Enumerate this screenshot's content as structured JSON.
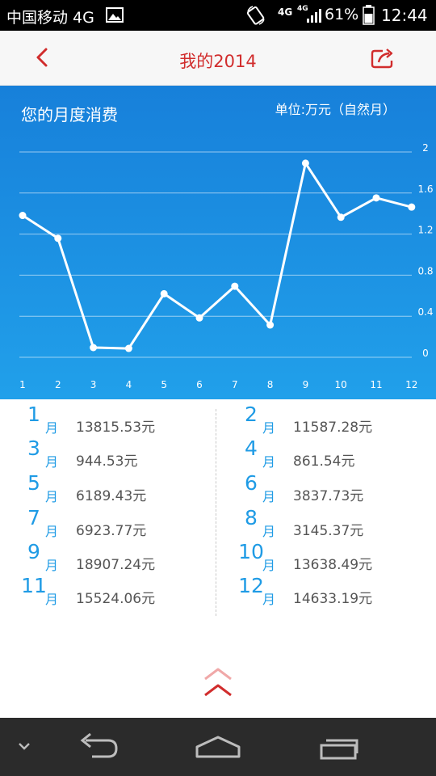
{
  "status_bar": {
    "carrier": "中国移动 4G",
    "network_1": "4G",
    "network_2": "4G",
    "battery": "61%",
    "time": "12:44",
    "icons": [
      "image-icon",
      "screen-rotation-icon",
      "signal-icon",
      "battery-icon"
    ]
  },
  "header": {
    "title": "我的2014",
    "back_icon": "chevron-left-icon",
    "share_icon": "share-icon"
  },
  "colors": {
    "accent": "#d12d2d",
    "chart_bg_top": "#1780da",
    "chart_bg_bottom": "#21a0ea",
    "month_number": "#1f9be5",
    "amount_text": "#555555"
  },
  "chart_title": "您的月度消费",
  "chart_unit": "单位:万元（自然月）",
  "chart_data": {
    "type": "line",
    "x": [
      1,
      2,
      3,
      4,
      5,
      6,
      7,
      8,
      9,
      10,
      11,
      12
    ],
    "x_tick_labels": [
      "1",
      "2",
      "3",
      "4",
      "5",
      "6",
      "7",
      "8",
      "9",
      "10",
      "11",
      "12"
    ],
    "series": [
      {
        "values": [
          1.3815553,
          1.1587228,
          0.0944553,
          0.0861554,
          0.6189443,
          0.3837773,
          0.6923777,
          0.3145337,
          1.8907224,
          1.3638449,
          1.5524006,
          1.4633319
        ]
      }
    ],
    "y_ticks": [
      "0",
      "0.4",
      "0.8",
      "1.2",
      "1.6",
      "2"
    ],
    "ylim": [
      0,
      2
    ],
    "grid": true,
    "y_axis_side": "right"
  },
  "months": [
    {
      "num": "1",
      "unit": "月",
      "amount": "13815.53元"
    },
    {
      "num": "2",
      "unit": "月",
      "amount": "11587.28元"
    },
    {
      "num": "3",
      "unit": "月",
      "amount": "944.53元"
    },
    {
      "num": "4",
      "unit": "月",
      "amount": "861.54元"
    },
    {
      "num": "5",
      "unit": "月",
      "amount": "6189.43元"
    },
    {
      "num": "6",
      "unit": "月",
      "amount": "3837.73元"
    },
    {
      "num": "7",
      "unit": "月",
      "amount": "6923.77元"
    },
    {
      "num": "8",
      "unit": "月",
      "amount": "3145.37元"
    },
    {
      "num": "9",
      "unit": "月",
      "amount": "18907.24元"
    },
    {
      "num": "10",
      "unit": "月",
      "amount": "13638.49元"
    },
    {
      "num": "11",
      "unit": "月",
      "amount": "15524.06元"
    },
    {
      "num": "12",
      "unit": "月",
      "amount": "14633.19元"
    }
  ],
  "expand_icon": "double-chevron-up-icon",
  "nav_icons": [
    "hide-keyboard-chevron-icon",
    "back-icon",
    "home-icon",
    "recents-icon"
  ]
}
